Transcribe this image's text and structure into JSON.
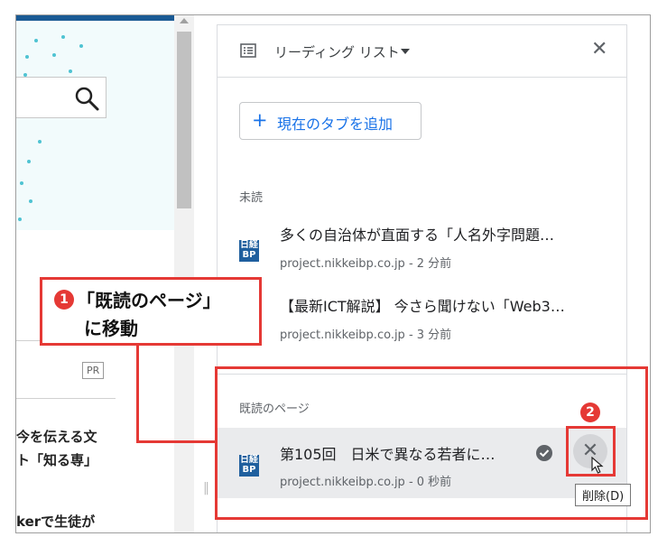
{
  "reading_list": {
    "title": "リーディング リスト",
    "add_tab_label": "現在のタブを追加",
    "unread_label": "未読",
    "read_label": "既読のページ",
    "unread_items": [
      {
        "title": "多くの自治体が直面する「人名外字問題…",
        "meta": "project.nikkeibp.co.jp - 2 分前"
      },
      {
        "title": "【最新ICT解説】 今さら聞けない「Web3…",
        "meta": "project.nikkeibp.co.jp - 3 分前"
      }
    ],
    "read_items": [
      {
        "title": "第105回　日米で異なる若者に…",
        "meta": "project.nikkeibp.co.jp - 0 秒前"
      }
    ],
    "favicon_text": "日経BP"
  },
  "left_page": {
    "pr_badge": "PR",
    "snippets": [
      "今を伝える文",
      "ト「知る専」",
      "kerで生徒が"
    ]
  },
  "annotations": {
    "callout_number": "1",
    "callout_line1": "「既読のページ」",
    "callout_line2": "に移動",
    "marker_number": "2",
    "tooltip": "削除(D)"
  },
  "colors": {
    "accent": "#1a73e8",
    "annotation_red": "#e53935",
    "favicon_blue": "#1f5f9e"
  }
}
